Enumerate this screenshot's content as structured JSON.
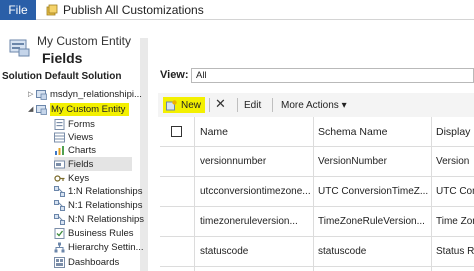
{
  "ribbon": {
    "file_label": "File",
    "publish_label": "Publish All Customizations"
  },
  "header": {
    "entity_name": "My Custom Entity",
    "page_title": "Fields"
  },
  "sidebar": {
    "solution_label": "Solution Default Solution",
    "items": [
      {
        "label": "msdyn_relationshipi...",
        "icon": "entity-icon"
      },
      {
        "label": "My Custom Entity",
        "icon": "entity-icon"
      },
      {
        "label": "Forms",
        "icon": "forms-icon"
      },
      {
        "label": "Views",
        "icon": "views-icon"
      },
      {
        "label": "Charts",
        "icon": "charts-icon"
      },
      {
        "label": "Fields",
        "icon": "fields-icon"
      },
      {
        "label": "Keys",
        "icon": "keys-icon"
      },
      {
        "label": "1:N Relationships",
        "icon": "relationship-icon"
      },
      {
        "label": "N:1 Relationships",
        "icon": "relationship-icon"
      },
      {
        "label": "N:N Relationships",
        "icon": "relationship-icon"
      },
      {
        "label": "Business Rules",
        "icon": "business-rules-icon"
      },
      {
        "label": "Hierarchy Settin...",
        "icon": "hierarchy-icon"
      },
      {
        "label": "Dashboards",
        "icon": "dashboards-icon"
      }
    ]
  },
  "view": {
    "label": "View:",
    "selected": "All"
  },
  "toolbar": {
    "new_label": "New",
    "edit_label": "Edit",
    "more_actions_label": "More Actions ▾"
  },
  "grid": {
    "columns": [
      "Name",
      "Schema Name",
      "Display"
    ],
    "rows": [
      [
        "versionnumber",
        "VersionNumber",
        "Version"
      ],
      [
        "utcconversiontimezone...",
        "UTC ConversionTimeZ...",
        "UTC Conve"
      ],
      [
        "timezoneruleversion...",
        "TimeZoneRuleVersion...",
        "Time Zone"
      ],
      [
        "statuscode",
        "statuscode",
        "Status R"
      ]
    ]
  },
  "colors": {
    "file_button": "#2a5fa8",
    "highlight": "#f3f000",
    "selected_row": "#e4e4e4"
  }
}
